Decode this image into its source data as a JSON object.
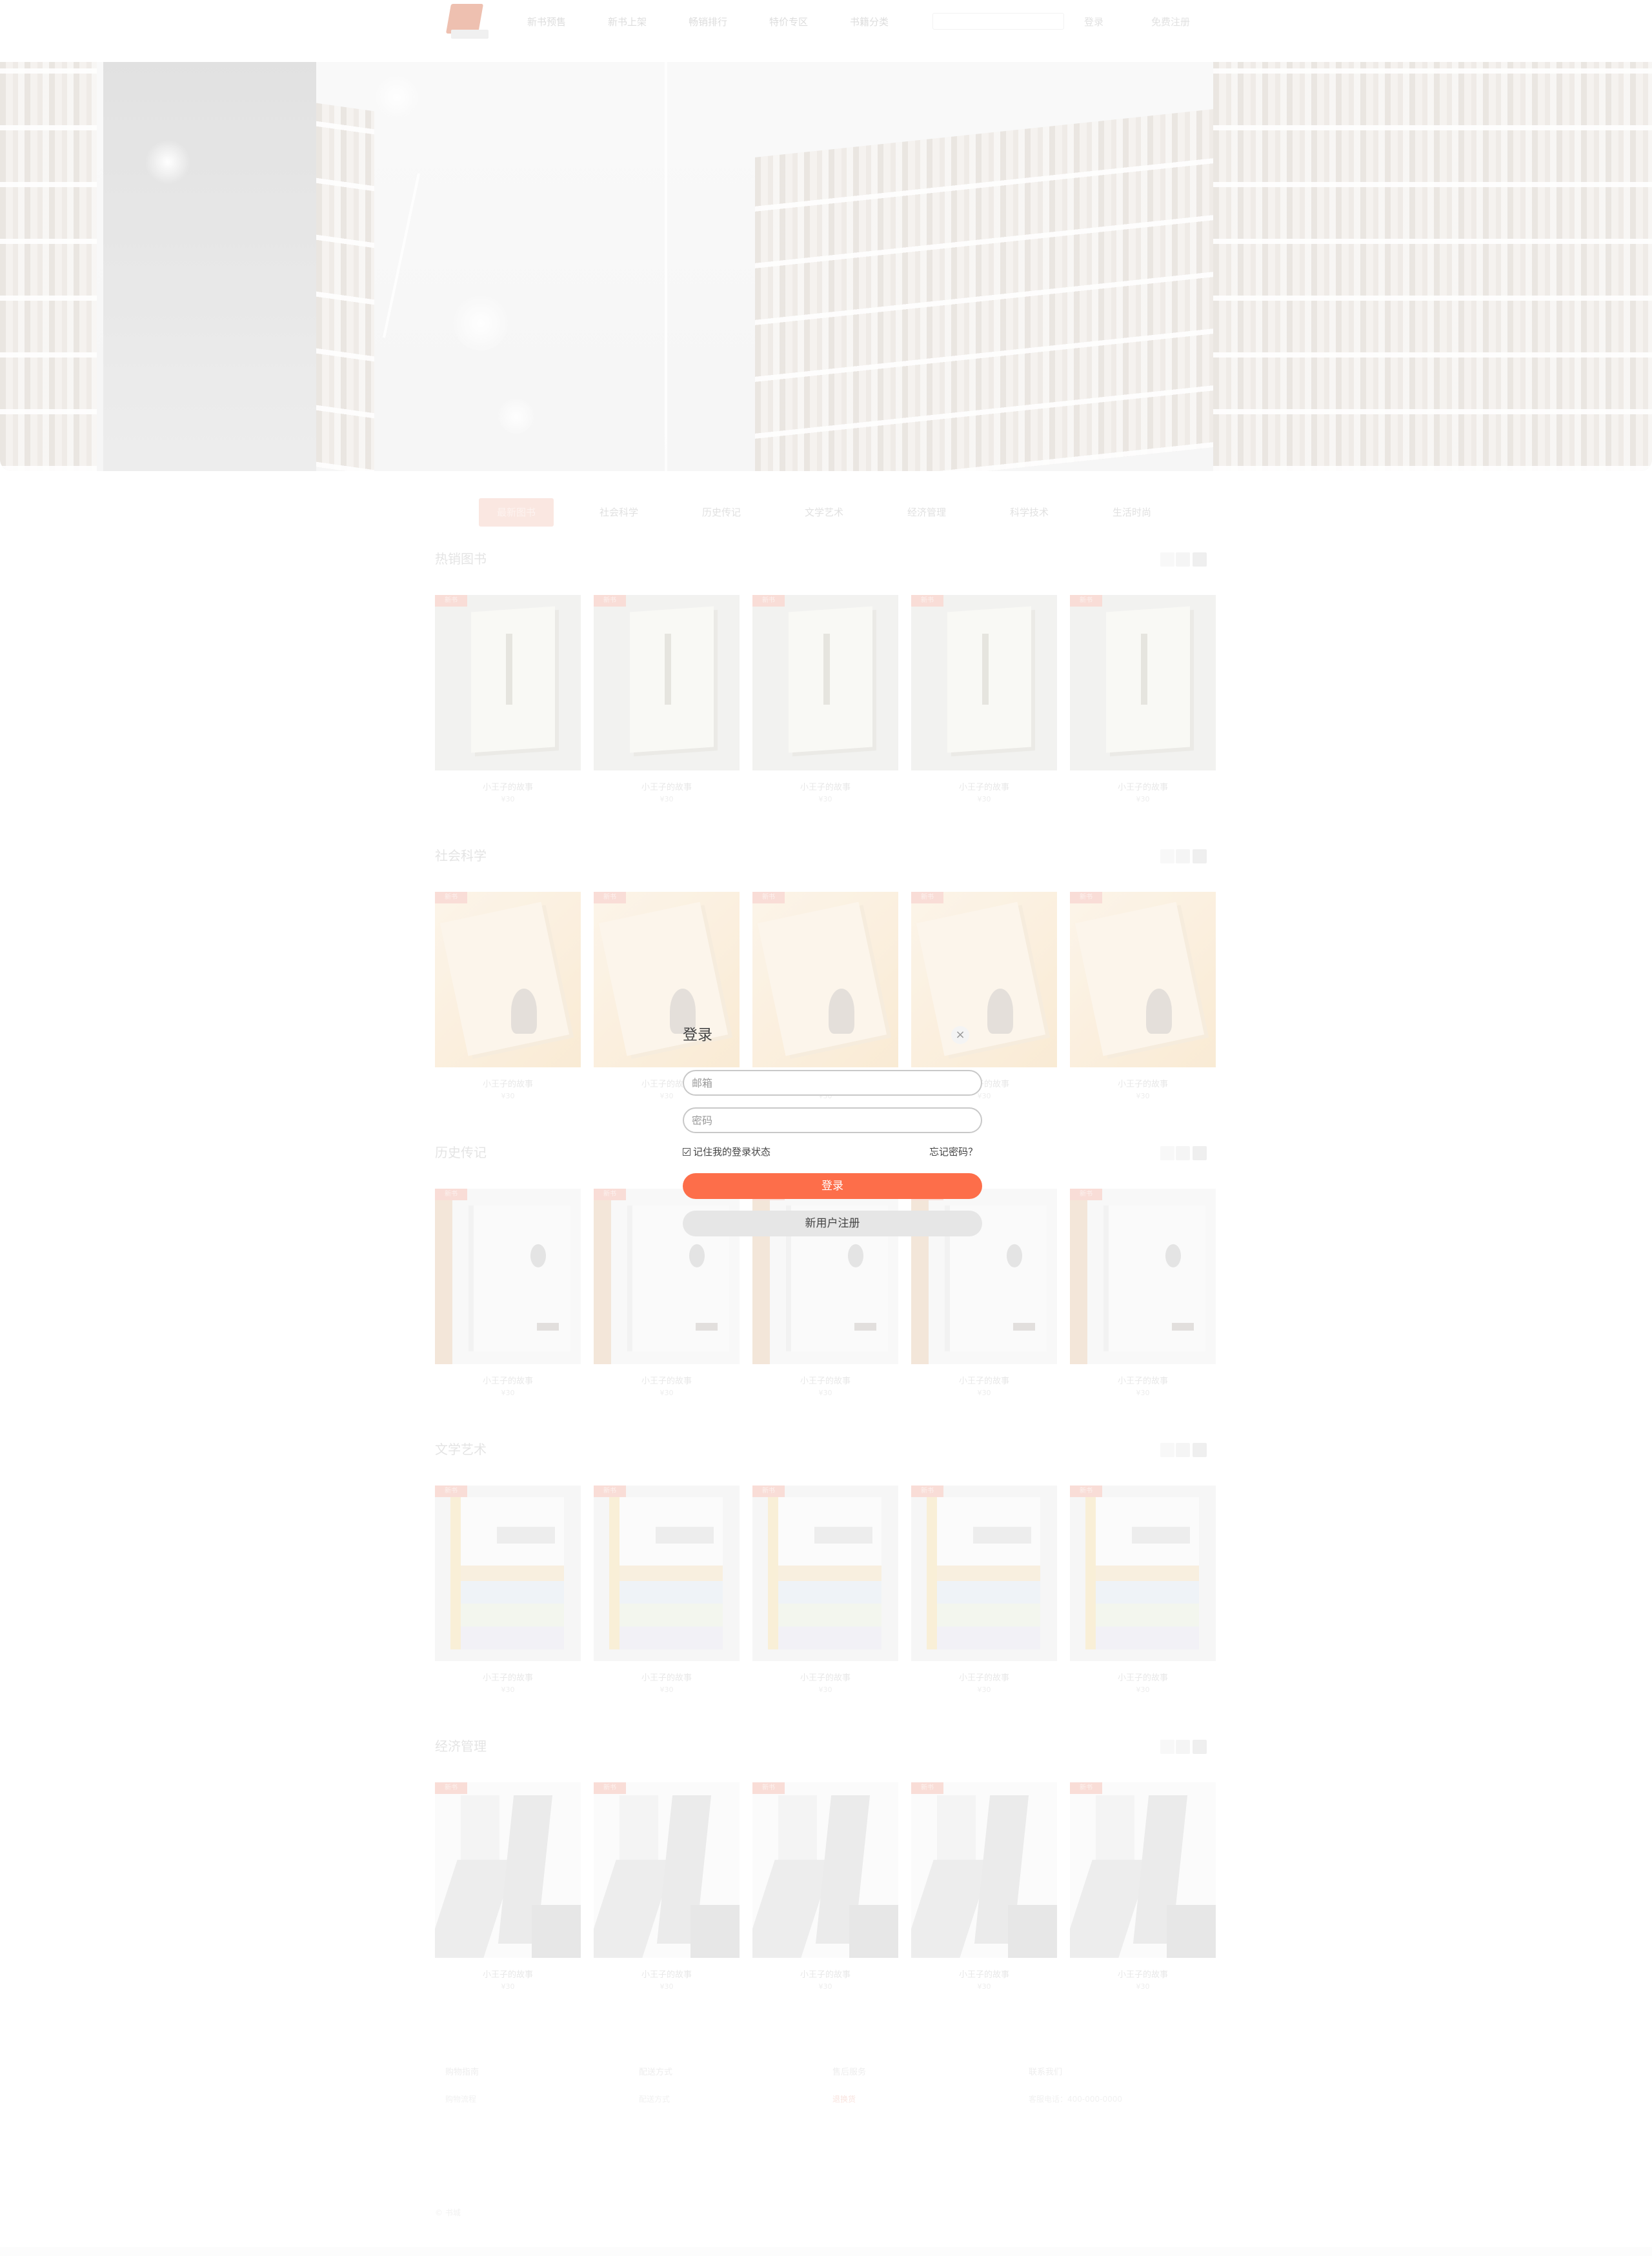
{
  "header": {
    "nav": [
      "新书预售",
      "新书上架",
      "畅销排行",
      "特价专区",
      "书籍分类"
    ],
    "search_placeholder": "",
    "links": [
      "登录",
      "免费注册"
    ]
  },
  "tabs": [
    "最新图书",
    "社会科学",
    "历史传记",
    "文学艺术",
    "经济管理",
    "科学技术",
    "生活时尚"
  ],
  "active_tab": 0,
  "sections": [
    {
      "title": "热销图书",
      "cover_style": "cv1",
      "books": [
        {
          "badge": "新书",
          "title": "小王子的故事",
          "price": "¥30"
        },
        {
          "badge": "新书",
          "title": "小王子的故事",
          "price": "¥30"
        },
        {
          "badge": "新书",
          "title": "小王子的故事",
          "price": "¥30"
        },
        {
          "badge": "新书",
          "title": "小王子的故事",
          "price": "¥30"
        },
        {
          "badge": "新书",
          "title": "小王子的故事",
          "price": "¥30"
        }
      ]
    },
    {
      "title": "社会科学",
      "cover_style": "cv2",
      "books": [
        {
          "badge": "新书",
          "title": "小王子的故事",
          "price": "¥30"
        },
        {
          "badge": "新书",
          "title": "小王子的故事",
          "price": "¥30"
        },
        {
          "badge": "新书",
          "title": "小王子的故事",
          "price": "¥30"
        },
        {
          "badge": "新书",
          "title": "小王子的故事",
          "price": "¥30"
        },
        {
          "badge": "新书",
          "title": "小王子的故事",
          "price": "¥30"
        }
      ]
    },
    {
      "title": "历史传记",
      "cover_style": "cv3",
      "books": [
        {
          "badge": "新书",
          "title": "小王子的故事",
          "price": "¥30"
        },
        {
          "badge": "新书",
          "title": "小王子的故事",
          "price": "¥30"
        },
        {
          "badge": "新书",
          "title": "小王子的故事",
          "price": "¥30"
        },
        {
          "badge": "新书",
          "title": "小王子的故事",
          "price": "¥30"
        },
        {
          "badge": "新书",
          "title": "小王子的故事",
          "price": "¥30"
        }
      ]
    },
    {
      "title": "文学艺术",
      "cover_style": "cv4",
      "books": [
        {
          "badge": "新书",
          "title": "小王子的故事",
          "price": "¥30"
        },
        {
          "badge": "新书",
          "title": "小王子的故事",
          "price": "¥30"
        },
        {
          "badge": "新书",
          "title": "小王子的故事",
          "price": "¥30"
        },
        {
          "badge": "新书",
          "title": "小王子的故事",
          "price": "¥30"
        },
        {
          "badge": "新书",
          "title": "小王子的故事",
          "price": "¥30"
        }
      ]
    },
    {
      "title": "经济管理",
      "cover_style": "cv5",
      "books": [
        {
          "badge": "新书",
          "title": "小王子的故事",
          "price": "¥30"
        },
        {
          "badge": "新书",
          "title": "小王子的故事",
          "price": "¥30"
        },
        {
          "badge": "新书",
          "title": "小王子的故事",
          "price": "¥30"
        },
        {
          "badge": "新书",
          "title": "小王子的故事",
          "price": "¥30"
        },
        {
          "badge": "新书",
          "title": "小王子的故事",
          "price": "¥30"
        }
      ]
    }
  ],
  "footer": {
    "columns": [
      {
        "head": "购物指南",
        "line": "购物流程"
      },
      {
        "head": "配送方式",
        "line": "配送方式"
      },
      {
        "head": "售后服务",
        "line": "退换货"
      },
      {
        "head": "联系我们",
        "line": "客服电话：400-000-0000"
      }
    ],
    "copyright": "© 书城"
  },
  "login_modal": {
    "title": "登录",
    "close": "×",
    "email_placeholder": "邮箱",
    "password_placeholder": "密码",
    "remember_label": "记住我的登录状态",
    "forgot_label": "忘记密码？",
    "login_button": "登录",
    "register_button": "新用户注册"
  },
  "colors": {
    "accent": "#fd6e4a",
    "secondary_button": "#e6e6e6",
    "overlay": "rgba(255,255,255,0.30)"
  }
}
